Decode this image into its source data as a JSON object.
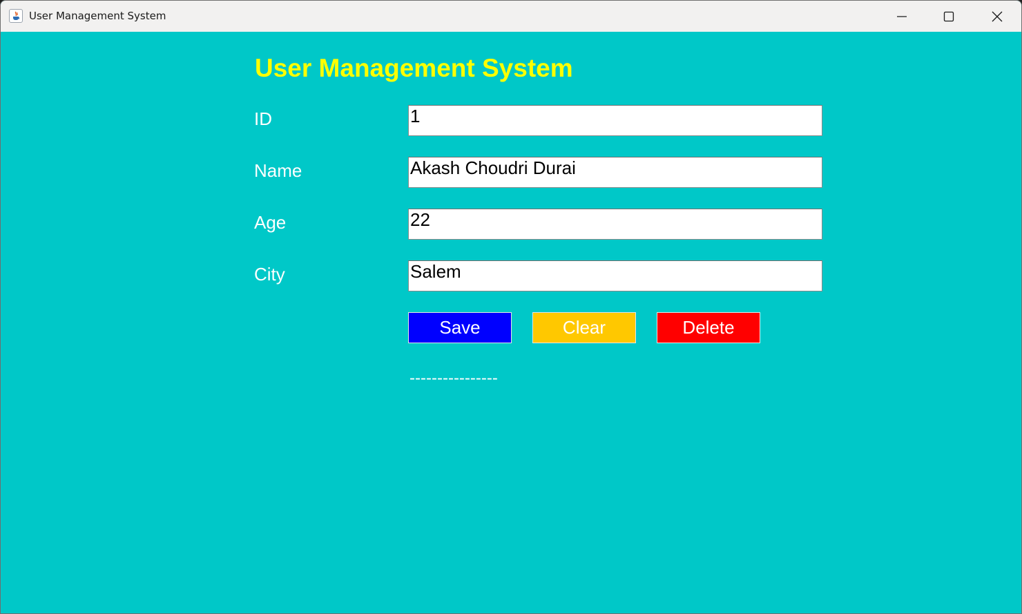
{
  "window": {
    "title": "User Management System",
    "app_icon": "java-cup-icon",
    "controls": [
      "minimize-icon",
      "maximize-icon",
      "close-icon"
    ]
  },
  "form": {
    "heading": "User Management System",
    "fields": [
      {
        "label": "ID",
        "value": "1"
      },
      {
        "label": "Name",
        "value": "Akash Choudri Durai"
      },
      {
        "label": "Age",
        "value": "22"
      },
      {
        "label": "City",
        "value": "Salem"
      }
    ],
    "buttons": [
      {
        "label": "Save",
        "color": "#0000ff"
      },
      {
        "label": "Clear",
        "color": "#ffc800"
      },
      {
        "label": "Delete",
        "color": "#ff0000"
      }
    ],
    "status": "----------------"
  },
  "colors": {
    "background": "#00c8c8",
    "heading": "#ffff00",
    "label": "#ffffff"
  }
}
